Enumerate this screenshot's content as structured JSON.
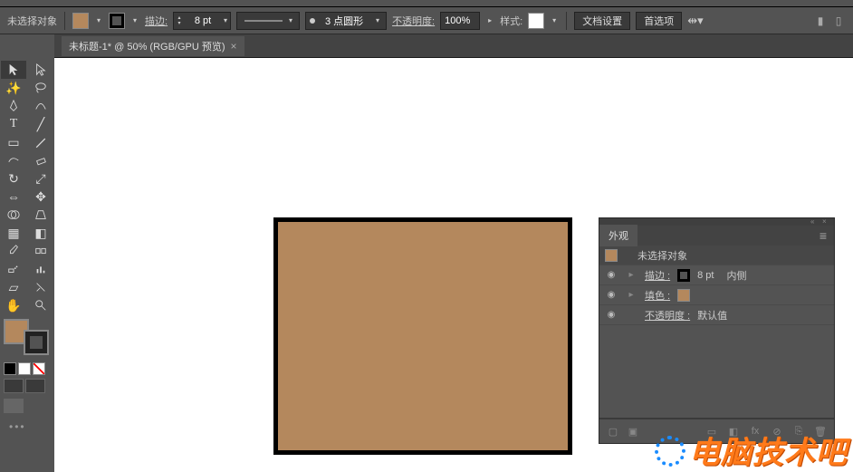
{
  "control_bar": {
    "no_selection": "未选择对象",
    "stroke_label": "描边:",
    "stroke_value": "8 pt",
    "profile_label": "",
    "brush_value": "3 点圆形",
    "opacity_label": "不透明度:",
    "opacity_value": "100%",
    "style_label": "样式:",
    "doc_setup": "文档设置",
    "preferences": "首选项",
    "fill_color": "#b4885d",
    "stroke_color": "#000000"
  },
  "tab": {
    "title": "未标题-1* @ 50% (RGB/GPU 预览)"
  },
  "canvas": {
    "rect_fill": "#b4885d",
    "rect_stroke": "#000000"
  },
  "appearance_panel": {
    "title": "外观",
    "object_label": "未选择对象",
    "stroke_label": "描边 :",
    "stroke_value": "8 pt",
    "stroke_align": "内侧",
    "fill_label": "填色 :",
    "opacity_label": "不透明度 :",
    "opacity_value": "默认值",
    "fill_color": "#b4885d",
    "stroke_color": "#000000"
  },
  "watermark": "电脑技术吧",
  "tools": [
    [
      "selection",
      "direct-selection"
    ],
    [
      "magic-wand",
      "lasso"
    ],
    [
      "pen",
      "curvature"
    ],
    [
      "type",
      "line"
    ],
    [
      "rectangle",
      "paintbrush"
    ],
    [
      "shaper",
      "eraser"
    ],
    [
      "rotate",
      "scale"
    ],
    [
      "width",
      "free-transform"
    ],
    [
      "shape-builder",
      "perspective"
    ],
    [
      "mesh",
      "gradient"
    ],
    [
      "eyedropper",
      "blend"
    ],
    [
      "symbol-sprayer",
      "column-graph"
    ],
    [
      "artboard",
      "slice"
    ],
    [
      "hand",
      "zoom"
    ]
  ]
}
